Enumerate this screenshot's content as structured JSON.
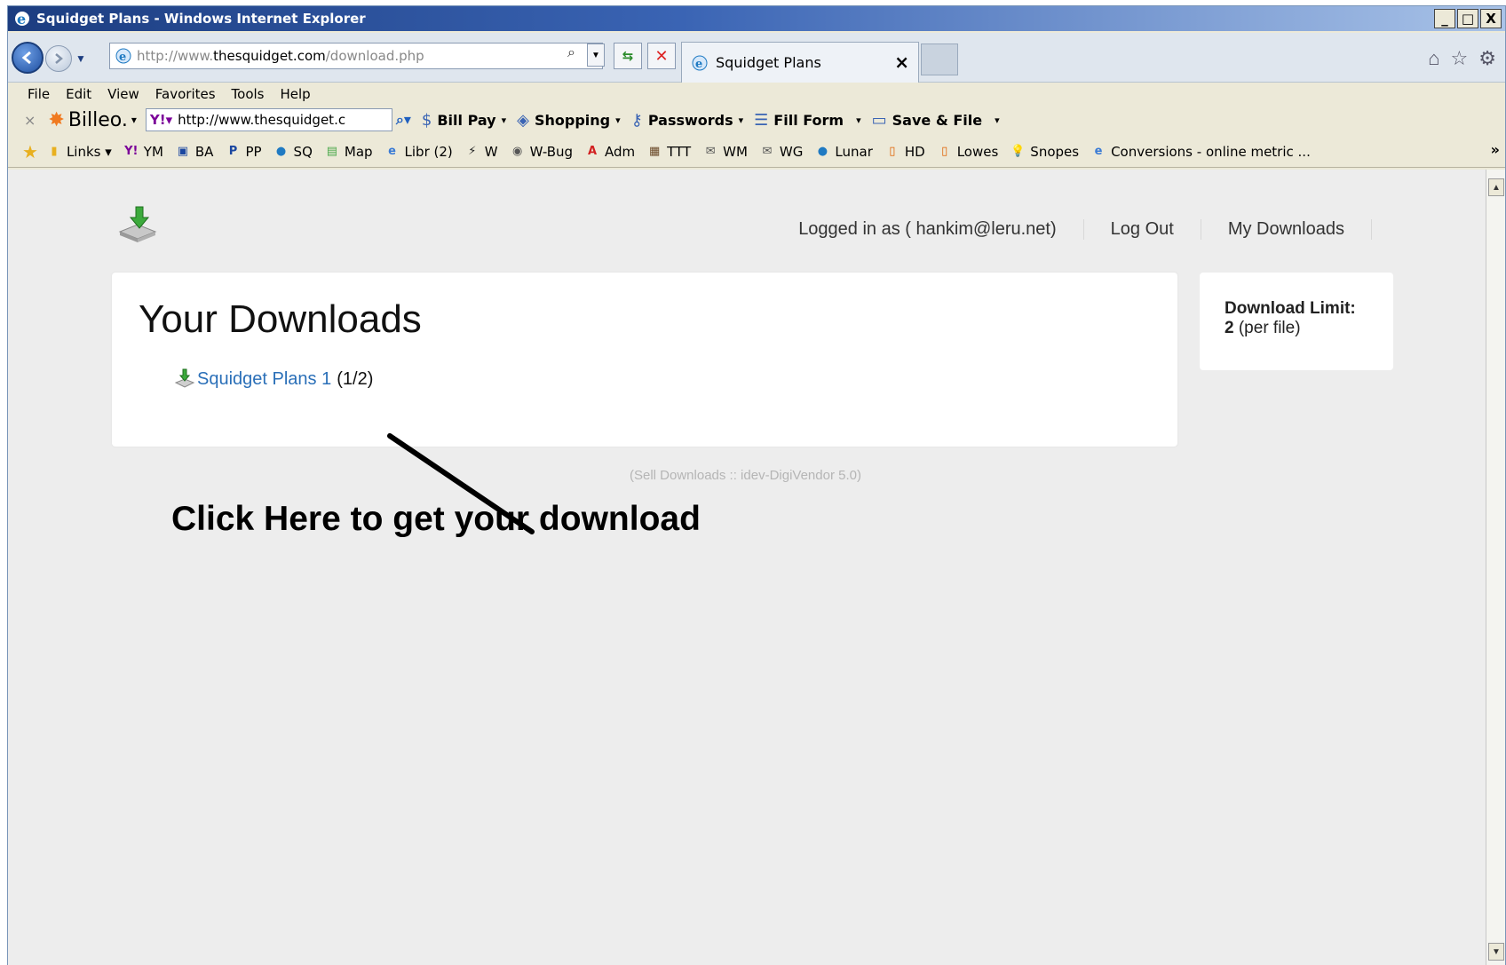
{
  "window": {
    "title": "Squidget Plans - Windows Internet Explorer",
    "controls": [
      "_",
      "□",
      "X"
    ]
  },
  "address_bar": {
    "url_prefix": "http://www.",
    "url_domain": "thesquidget.com",
    "url_path": "/download.php"
  },
  "tab": {
    "label": "Squidget Plans",
    "close": "×"
  },
  "menu": [
    "File",
    "Edit",
    "View",
    "Favorites",
    "Tools",
    "Help"
  ],
  "billeo_toolbar": {
    "close": "×",
    "brand": "Billeo.",
    "search_value": "http://www.thesquidget.c",
    "items": [
      "Bill Pay",
      "Shopping",
      "Passwords",
      "Fill Form",
      "Save & File"
    ]
  },
  "favorites": [
    {
      "label": "Links ▾",
      "icon": "folder-icon",
      "color": "#e8b020"
    },
    {
      "label": "YM",
      "icon": "yahoo-icon",
      "color": "#7b0099"
    },
    {
      "label": "BA",
      "icon": "bank-icon",
      "color": "#1b47a0"
    },
    {
      "label": "PP",
      "icon": "paypal-icon",
      "color": "#1b47a0"
    },
    {
      "label": "SQ",
      "icon": "globe-icon",
      "color": "#1f7ac2"
    },
    {
      "label": "Map",
      "icon": "map-icon",
      "color": "#4aa84a"
    },
    {
      "label": "Libr (2)",
      "icon": "ie-page-icon",
      "color": "#3a7bd5"
    },
    {
      "label": "W",
      "icon": "weather-icon",
      "color": "#222222"
    },
    {
      "label": "W-Bug",
      "icon": "weatherbug-icon",
      "color": "#555555"
    },
    {
      "label": "Adm",
      "icon": "letter-a-icon",
      "color": "#d22020"
    },
    {
      "label": "TTT",
      "icon": "photo-icon",
      "color": "#6b4a2a"
    },
    {
      "label": "WM",
      "icon": "mail-icon",
      "color": "#555555"
    },
    {
      "label": "WG",
      "icon": "mail-icon",
      "color": "#555555"
    },
    {
      "label": "Lunar",
      "icon": "globe-icon",
      "color": "#1f7ac2"
    },
    {
      "label": "HD",
      "icon": "page-icon",
      "color": "#e06000"
    },
    {
      "label": "Lowes",
      "icon": "page-icon",
      "color": "#e06000"
    },
    {
      "label": "Snopes",
      "icon": "bulb-icon",
      "color": "#e0b000"
    },
    {
      "label": "Conversions - online metric ...",
      "icon": "ie-page-icon",
      "color": "#3a7bd5"
    }
  ],
  "favorites_more": "»",
  "site": {
    "nav": {
      "logged_in": "Logged in as ( hankim@leru.net)",
      "logout": "Log Out",
      "my_downloads": "My Downloads"
    },
    "heading": "Your Downloads",
    "download": {
      "link": "Squidget Plans 1",
      "count": "(1/2)"
    },
    "sidebar": {
      "label": "Download Limit:",
      "value": "2",
      "suffix": "(per file)"
    },
    "footer": "(Sell Downloads :: idev-DigiVendor 5.0)"
  },
  "annotation": "Click Here to get your download"
}
